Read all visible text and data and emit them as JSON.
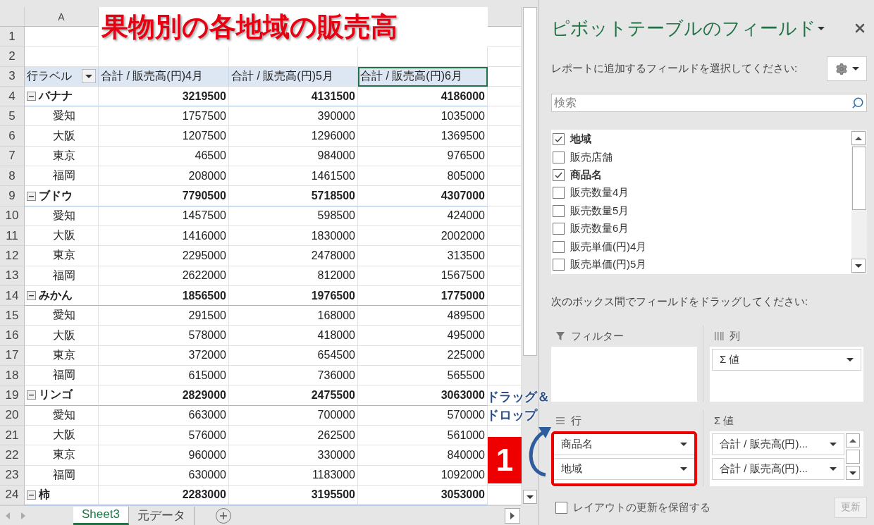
{
  "sheet": {
    "column_header": "A",
    "title_overlay": "果物別の各地域の販売高",
    "row_numbers": [
      "1",
      "2",
      "3",
      "4",
      "5",
      "6",
      "7",
      "8",
      "9",
      "10",
      "11",
      "12",
      "13",
      "14",
      "15",
      "16",
      "17",
      "18",
      "19",
      "20",
      "21",
      "22",
      "23",
      "24"
    ],
    "pivot": {
      "row_label": "行ラベル",
      "columns": [
        "合計 / 販売高(円)4月",
        "合計 / 販売高(円)5月",
        "合計 / 販売高(円)6月"
      ],
      "groups": [
        {
          "label": "バナナ",
          "expanded": true,
          "values": [
            "3219500",
            "4131500",
            "4186000"
          ],
          "children": [
            {
              "label": "愛知",
              "values": [
                "1757500",
                "390000",
                "1035000"
              ]
            },
            {
              "label": "大阪",
              "values": [
                "1207500",
                "1296000",
                "1369500"
              ]
            },
            {
              "label": "東京",
              "values": [
                "46500",
                "984000",
                "976500"
              ]
            },
            {
              "label": "福岡",
              "values": [
                "208000",
                "1461500",
                "805000"
              ]
            }
          ]
        },
        {
          "label": "ブドウ",
          "expanded": true,
          "values": [
            "7790500",
            "5718500",
            "4307000"
          ],
          "children": [
            {
              "label": "愛知",
              "values": [
                "1457500",
                "598500",
                "424000"
              ]
            },
            {
              "label": "大阪",
              "values": [
                "1416000",
                "1830000",
                "2002000"
              ]
            },
            {
              "label": "東京",
              "values": [
                "2295000",
                "2478000",
                "313500"
              ]
            },
            {
              "label": "福岡",
              "values": [
                "2622000",
                "812000",
                "1567500"
              ]
            }
          ]
        },
        {
          "label": "みかん",
          "expanded": true,
          "values": [
            "1856500",
            "1976500",
            "1775000"
          ],
          "children": [
            {
              "label": "愛知",
              "values": [
                "291500",
                "168000",
                "489500"
              ]
            },
            {
              "label": "大阪",
              "values": [
                "578000",
                "418000",
                "495000"
              ]
            },
            {
              "label": "東京",
              "values": [
                "372000",
                "654500",
                "225000"
              ]
            },
            {
              "label": "福岡",
              "values": [
                "615000",
                "736000",
                "565500"
              ]
            }
          ]
        },
        {
          "label": "リンゴ",
          "expanded": true,
          "values": [
            "2829000",
            "2475500",
            "3063000"
          ],
          "children": [
            {
              "label": "愛知",
              "values": [
                "663000",
                "700000",
                "570000"
              ]
            },
            {
              "label": "大阪",
              "values": [
                "576000",
                "262500",
                "561000"
              ]
            },
            {
              "label": "東京",
              "values": [
                "960000",
                "330000",
                "840000"
              ]
            },
            {
              "label": "福岡",
              "values": [
                "630000",
                "1183000",
                "1092000"
              ]
            }
          ]
        },
        {
          "label": "柿",
          "expanded": true,
          "values": [
            "2283000",
            "3195500",
            "3053000"
          ]
        }
      ]
    },
    "sheet_tabs": [
      {
        "label": "Sheet3",
        "selected": true
      },
      {
        "label": "元データ",
        "selected": false
      }
    ]
  },
  "annotation": {
    "lines": [
      "ドラッグ＆",
      "ドロップ"
    ],
    "step": "1"
  },
  "panel": {
    "title": "ピボットテーブルのフィールド",
    "prompt": "レポートに追加するフィールドを選択してください:",
    "search": {
      "placeholder": "検索"
    },
    "fields": [
      {
        "label": "地域",
        "checked": true
      },
      {
        "label": "販売店舗",
        "checked": false
      },
      {
        "label": "商品名",
        "checked": true
      },
      {
        "label": "販売数量4月",
        "checked": false
      },
      {
        "label": "販売数量5月",
        "checked": false
      },
      {
        "label": "販売数量6月",
        "checked": false
      },
      {
        "label": "販売単価(円)4月",
        "checked": false
      },
      {
        "label": "販売単価(円)5月",
        "checked": false
      }
    ],
    "areas_prompt": "次のボックス間でフィールドをドラッグしてください:",
    "areas": [
      {
        "kind": "filter",
        "label": "フィルター"
      },
      {
        "kind": "columns",
        "label": "列",
        "items": [
          "Σ 値"
        ]
      },
      {
        "kind": "rows",
        "label": "行",
        "highlighted": true,
        "items": [
          "商品名",
          "地域"
        ]
      },
      {
        "kind": "values",
        "label": "Σ 値",
        "items": [
          "合計 / 販売高(円)...",
          "合計 / 販売高(円)..."
        ]
      }
    ],
    "defer": {
      "label": "レイアウトの更新を保留する",
      "checked": false
    },
    "update_button": {
      "label": "更新",
      "disabled": true
    }
  }
}
